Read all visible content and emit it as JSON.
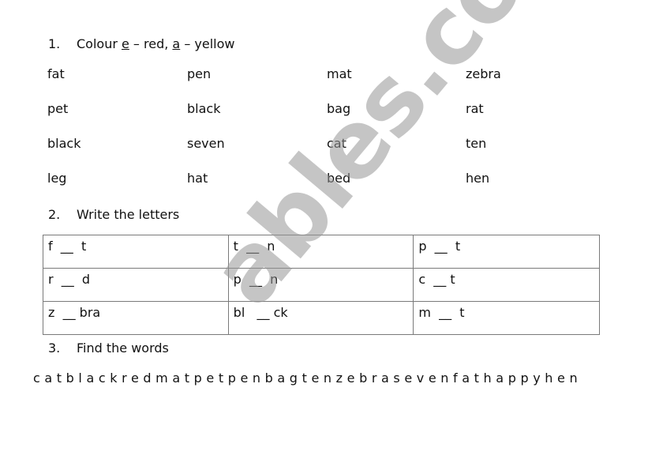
{
  "section1": {
    "number": "1.",
    "text_prefix": "Colour ",
    "letter1": "e",
    "text_mid1": " – red, ",
    "letter2": "a",
    "text_mid2": " – yellow",
    "words": [
      [
        "fat",
        "pen",
        "mat",
        "zebra"
      ],
      [
        "pet",
        "black",
        "bag",
        "rat"
      ],
      [
        "black",
        "seven",
        "cat",
        "ten"
      ],
      [
        "leg",
        "hat",
        "bed",
        "hen"
      ]
    ]
  },
  "section2": {
    "number": "2.",
    "title": "Write the letters",
    "table": [
      [
        "f  __  t",
        "t  __  n",
        "p  __  t"
      ],
      [
        "r  __  d",
        "p  __  n",
        "c  __ t"
      ],
      [
        "z  __ bra",
        "bl   __ ck",
        "m  __  t"
      ]
    ]
  },
  "section3": {
    "number": "3.",
    "title": "Find the words",
    "letters": "catblackredmatpetpenbagtenzebrasevenfathappyhen"
  },
  "watermark": {
    "text": "ables.com",
    "color": "#969696"
  }
}
